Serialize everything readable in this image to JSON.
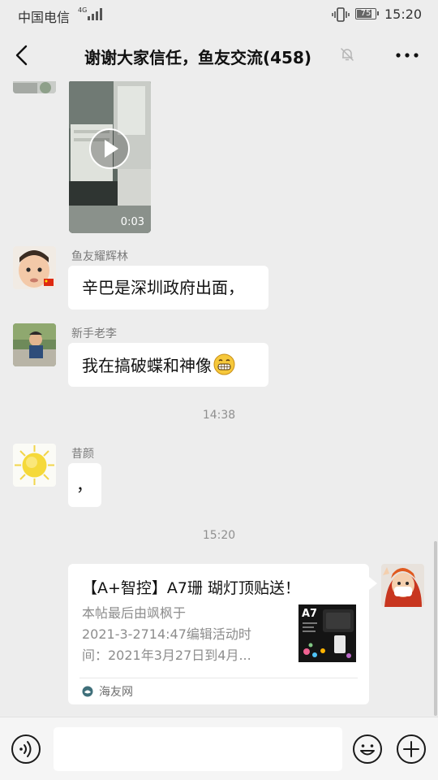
{
  "status_bar": {
    "carrier": "中国电信",
    "network": "4G",
    "battery": "75",
    "time": "15:20"
  },
  "header": {
    "back_icon": "back-chevron-icon",
    "title": "谢谢大家信任，鱼友交流(458)",
    "mute_icon": "bell-muted-icon",
    "more_icon": "more-dots-icon"
  },
  "messages": {
    "video": {
      "duration": "0:03"
    },
    "m1": {
      "sender": "鱼友耀辉林",
      "text": "辛巴是深圳政府出面，"
    },
    "m2": {
      "sender": "新手老李",
      "text": "我在搞破蝶和神像"
    },
    "time1": "14:38",
    "m3": {
      "sender": "昔颜",
      "text": "，"
    },
    "time2": "15:20",
    "card": {
      "title": "【A+智控】A7珊 瑚灯顶贴送！",
      "desc_lines": [
        "本帖最后由飒枫于",
        "2021-3-2714:47编辑活动时",
        "间：2021年3月27日到4月..."
      ],
      "thumb_label": "A7",
      "source": "海友网"
    }
  },
  "input_bar": {
    "voice_icon": "voice-icon",
    "input_value": "",
    "emoji_icon": "emoji-icon",
    "plus_icon": "plus-icon"
  },
  "colors": {
    "background": "#ededed",
    "bubble": "#ffffff",
    "meta_text": "#8f8f8f"
  }
}
